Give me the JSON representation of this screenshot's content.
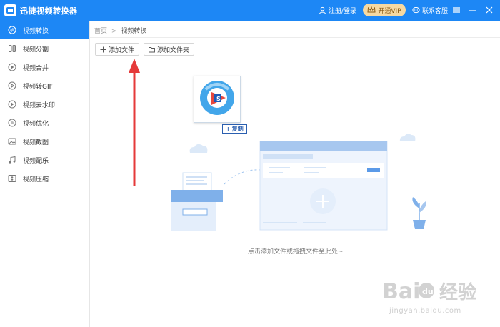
{
  "app": {
    "title": "迅捷视频转换器",
    "accent_color": "#1d87f5"
  },
  "titlebar": {
    "login_label": "注册/登录",
    "login_icon": "user-icon",
    "vip_label": "开通VIP",
    "vip_icon": "crown-icon",
    "service_label": "联系客服",
    "service_icon": "chat-bubble-icon",
    "menu_icon": "hamburger-menu-icon",
    "minimize_icon": "minimize-icon",
    "close_icon": "close-icon"
  },
  "sidebar": {
    "items": [
      {
        "label": "视频转换",
        "icon": "convert-icon",
        "active": true
      },
      {
        "label": "视频分割",
        "icon": "split-icon",
        "active": false
      },
      {
        "label": "视频合并",
        "icon": "merge-icon",
        "active": false
      },
      {
        "label": "视频转GIF",
        "icon": "gif-icon",
        "active": false
      },
      {
        "label": "视频去水印",
        "icon": "watermark-remove-icon",
        "active": false
      },
      {
        "label": "视频优化",
        "icon": "optimize-icon",
        "active": false
      },
      {
        "label": "视频截图",
        "icon": "screenshot-icon",
        "active": false
      },
      {
        "label": "视频配乐",
        "icon": "music-icon",
        "active": false
      },
      {
        "label": "视频压缩",
        "icon": "compress-icon",
        "active": false
      }
    ]
  },
  "breadcrumb": {
    "home": "首页",
    "separator": ">",
    "current": "视频转换"
  },
  "toolbar": {
    "add_file_label": "添加文件",
    "add_folder_label": "添加文件夹"
  },
  "drop_zone": {
    "hint": "点击添加文件或拖拽文件至此处~"
  },
  "drag_preview": {
    "copy_label": "复制",
    "badge_icon": "plus-icon"
  },
  "watermark": {
    "brand": "Baidu 经验",
    "url": "jingyan.baidu.com"
  }
}
